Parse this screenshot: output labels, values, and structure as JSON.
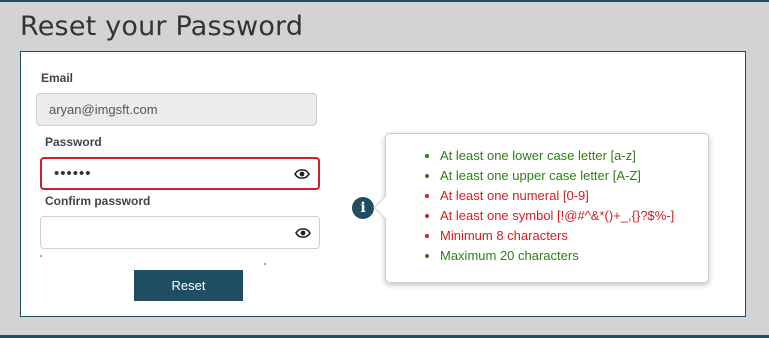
{
  "title": "Reset your Password",
  "form": {
    "email_label": "Email",
    "email_value": "aryan@imgsft.com",
    "password_label": "Password",
    "password_value": "••••••",
    "confirm_label": "Confirm password",
    "confirm_value": "",
    "reset_label": "Reset"
  },
  "info_icon_glyph": "i",
  "rules": [
    {
      "text": "At least one lower case letter [a-z]",
      "status": "ok"
    },
    {
      "text": "At least one upper case letter [A-Z]",
      "status": "ok"
    },
    {
      "text": "At least one numeral [0-9]",
      "status": "fail"
    },
    {
      "text": "At least one symbol [!@#^&*()+_,{}?$%-]",
      "status": "fail"
    },
    {
      "text": "Minimum 8 characters",
      "status": "fail"
    },
    {
      "text": "Maximum 20 characters",
      "status": "ok"
    }
  ],
  "colors": {
    "accent": "#1f4e63",
    "ok": "#2e7d1a",
    "fail": "#d21f26",
    "error_border": "#d21f26"
  }
}
